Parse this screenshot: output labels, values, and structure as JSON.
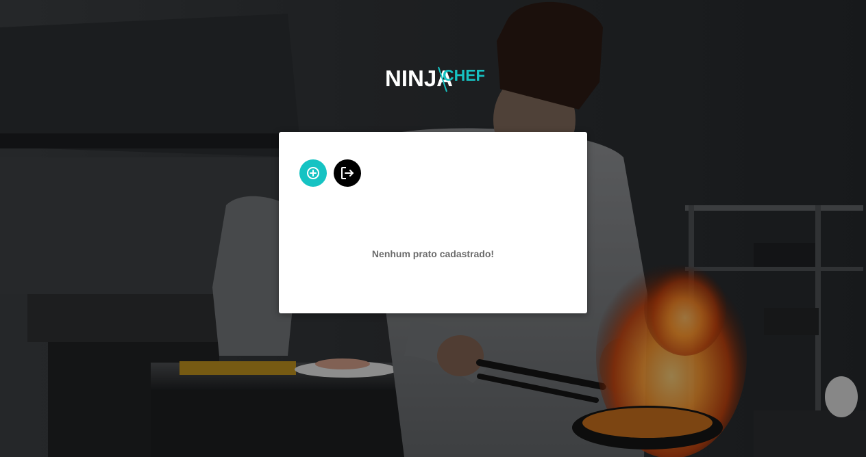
{
  "brand": {
    "part1": "NINJA",
    "part2": "CHEF"
  },
  "actions": {
    "add_icon": "plus-circle-icon",
    "logout_icon": "logout-icon"
  },
  "main": {
    "empty_message": "Nenhum prato cadastrado!"
  },
  "colors": {
    "accent": "#16c3c3",
    "logout": "#000000",
    "panel": "#ffffff",
    "message": "#6b6b6b"
  }
}
